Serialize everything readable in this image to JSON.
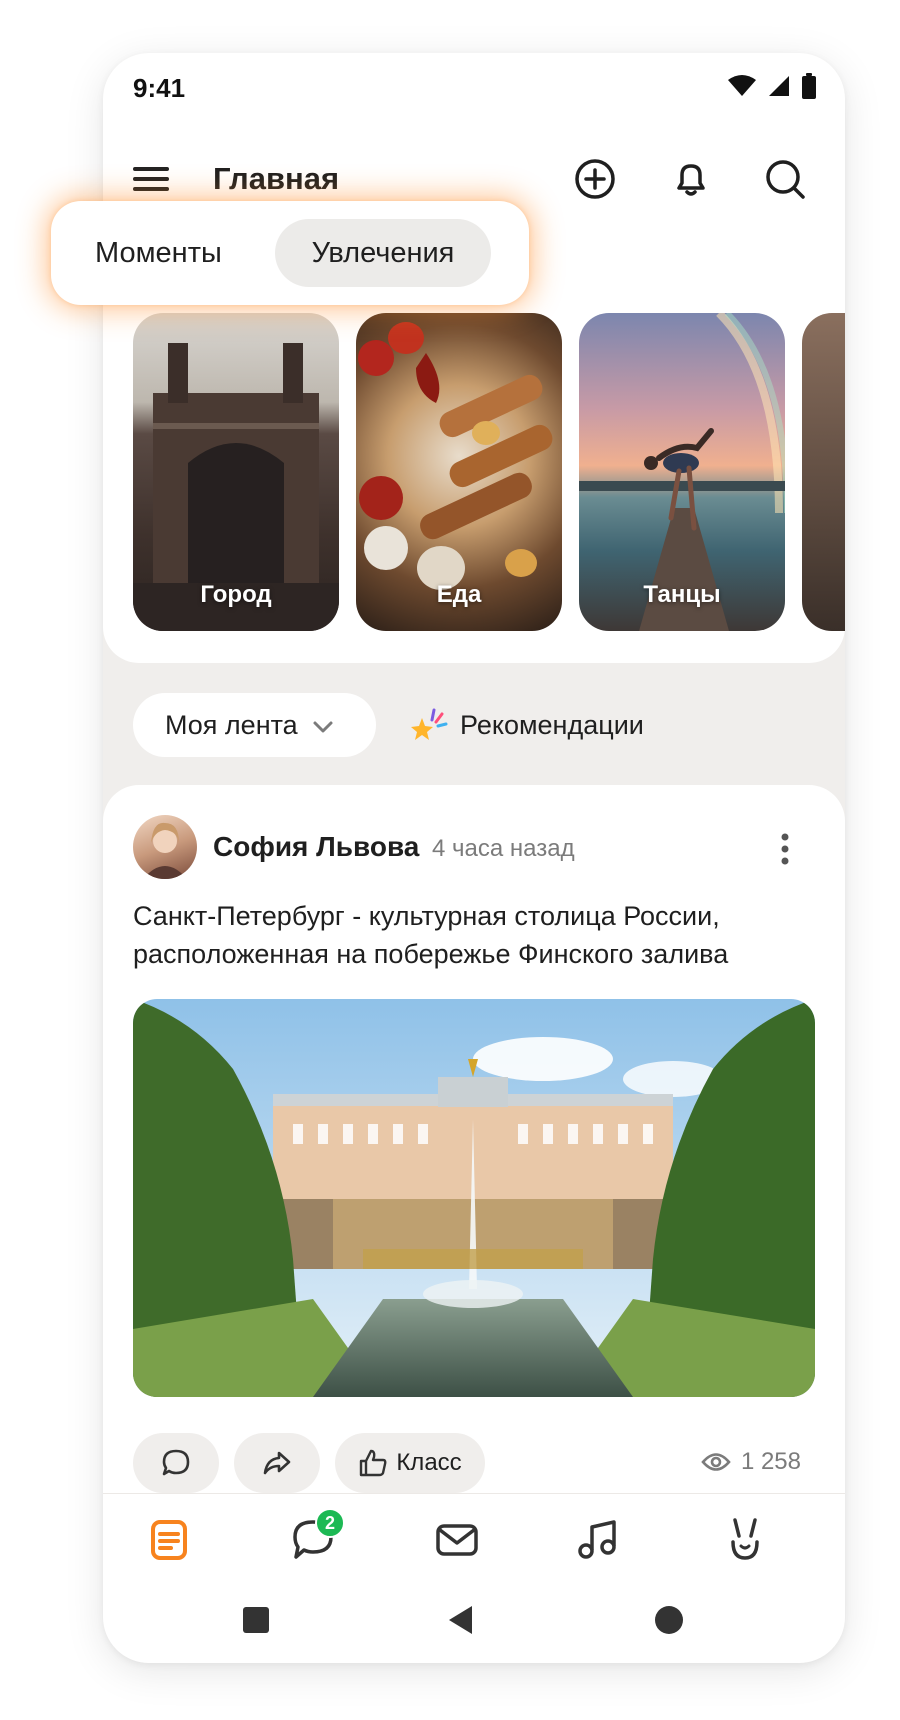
{
  "status_bar": {
    "time": "9:41"
  },
  "header": {
    "title": "Главная"
  },
  "tabs": [
    {
      "label": "Моменты",
      "active": false
    },
    {
      "label": "Увлечения",
      "active": true
    }
  ],
  "stories": [
    {
      "label": "Город"
    },
    {
      "label": "Еда"
    },
    {
      "label": "Танцы"
    },
    {
      "label": ""
    }
  ],
  "feed_switcher": {
    "my_feed_label": "Моя лента",
    "recommendations_label": "Рекомендации"
  },
  "post": {
    "author": "София Львова",
    "time": "4 часа назад",
    "text": "Санкт-Петербург - культурная столица России, расположенная на побережье Финского залива",
    "actions": {
      "class_label": "Класс"
    },
    "views": "1 258"
  },
  "bottom_nav": {
    "items": [
      {
        "icon": "feed-icon",
        "active": true
      },
      {
        "icon": "chat-icon",
        "badge": "2"
      },
      {
        "icon": "mail-icon"
      },
      {
        "icon": "music-icon"
      },
      {
        "icon": "games-icon"
      }
    ]
  },
  "colors": {
    "accent": "#f7831e",
    "badge": "#1db954"
  }
}
